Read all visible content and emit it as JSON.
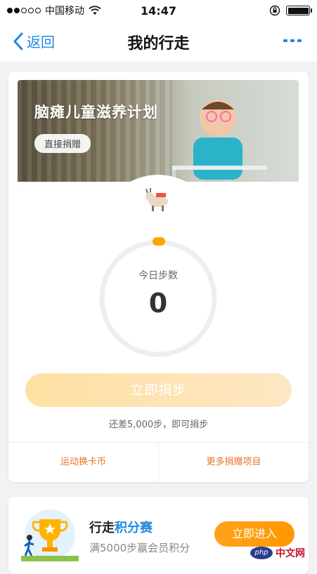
{
  "status_bar": {
    "carrier": "中国移动",
    "time": "14:47"
  },
  "nav": {
    "back_label": "返回",
    "title": "我的行走"
  },
  "banner": {
    "title": "脑瘫儿童滋养计划",
    "donate_label": "直接捐赠"
  },
  "steps": {
    "label": "今日步数",
    "value": "0",
    "donate_button": "立即捐步",
    "hint": "还差5,000步，即可捐步"
  },
  "links": {
    "left": "运动换卡币",
    "right": "更多捐赠项目"
  },
  "promo": {
    "title_prefix": "行走",
    "title_accent": "积分赛",
    "subtitle": "满5000步赢会员积分",
    "enter_button": "立即进入"
  },
  "watermark": {
    "logo": "php",
    "text": "中文网"
  },
  "colors": {
    "accent_blue": "#1e88e5",
    "accent_orange": "#ff9800",
    "link_orange": "#e8742a",
    "ring_dot": "#ffa500"
  }
}
